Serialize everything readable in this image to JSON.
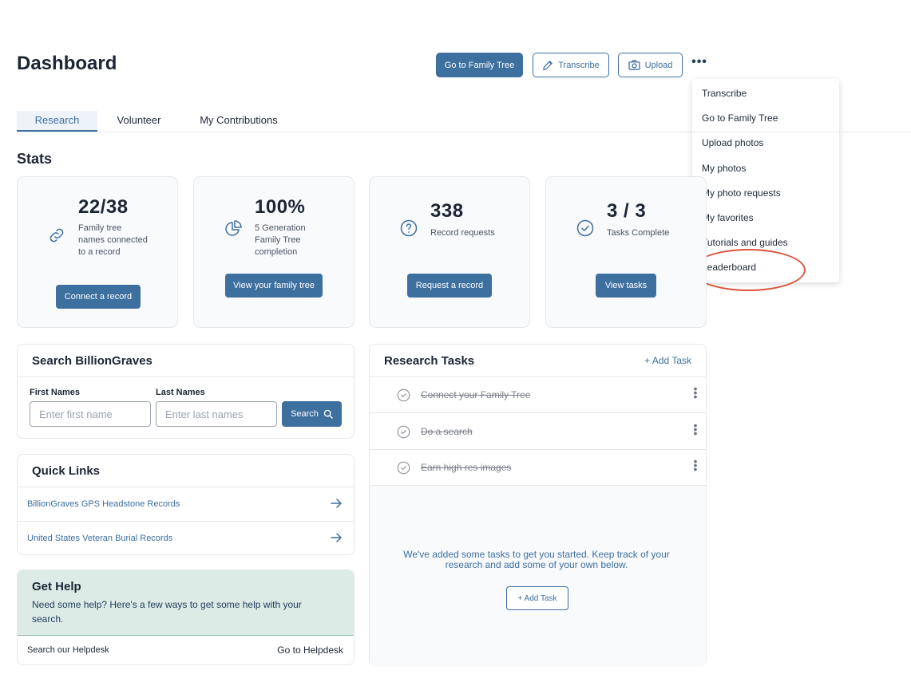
{
  "page_title": "Dashboard",
  "header": {
    "go_family_tree": "Go to Family Tree",
    "transcribe": "Transcribe",
    "upload": "Upload",
    "more": "•••"
  },
  "menu": {
    "items": [
      "Transcribe",
      "Go to Family Tree",
      "Upload photos",
      "My photos",
      "My photo requests",
      "My favorites",
      "Tutorials and guides",
      "Leaderboard"
    ]
  },
  "tabs": [
    "Research",
    "Volunteer",
    "My Contributions"
  ],
  "stats": {
    "heading": "Stats",
    "cards": [
      {
        "value": "22/38",
        "label": "Family tree names connected to a record",
        "button": "Connect a record"
      },
      {
        "value": "100%",
        "label": "5 Generation Family Tree completion",
        "button": "View your family tree"
      },
      {
        "value": "338",
        "label": "Record requests",
        "button": "Request a record"
      },
      {
        "value": "3 / 3",
        "label": "Tasks Complete",
        "button": "View tasks"
      }
    ]
  },
  "search": {
    "heading": "Search BillionGraves",
    "first_label": "First Names",
    "first_placeholder": "Enter first name",
    "last_label": "Last Names",
    "last_placeholder": "Enter last names",
    "button": "Search"
  },
  "quick_links": {
    "heading": "Quick Links",
    "items": [
      "BillionGraves GPS Headstone Records",
      "United States Veteran Burial Records"
    ]
  },
  "help": {
    "heading": "Get Help",
    "text": "Need some help? Here's a few ways to get some help with your search.",
    "row_label": "Search our Helpdesk",
    "row_link": "Go to Helpdesk"
  },
  "tasks": {
    "heading": "Research Tasks",
    "add_link": "+ Add Task",
    "items": [
      "Connect your Family Tree",
      "Do a search",
      "Earn high res images"
    ],
    "empty_text": "We've added some tasks to get you started. Keep track of your research and add some of your own below.",
    "add_button": "+ Add Task"
  },
  "colors": {
    "primary": "#3d6f9f",
    "highlight": "#d9533c",
    "help_bg": "#dcebe6"
  }
}
